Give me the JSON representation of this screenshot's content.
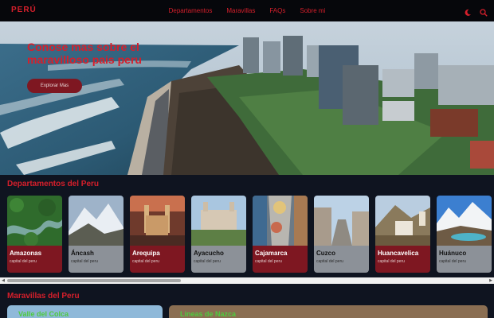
{
  "brand": "PERÚ",
  "nav": {
    "links": [
      "Departamentos",
      "Maravillas",
      "FAQs",
      "Sobre mi"
    ],
    "icons": [
      "moon-icon",
      "search-icon"
    ]
  },
  "hero": {
    "title": "Conose mas sobre el maravilloso pais peru",
    "button": "Explorar Mas"
  },
  "departments": {
    "title": "Departamentos del Peru",
    "items": [
      {
        "name": "Amazonas",
        "sub": "capital del peru",
        "style": "red"
      },
      {
        "name": "Áncash",
        "sub": "capital del peru",
        "style": "gray"
      },
      {
        "name": "Arequipa",
        "sub": "capital del peru",
        "style": "red"
      },
      {
        "name": "Ayacucho",
        "sub": "capital del peru",
        "style": "gray"
      },
      {
        "name": "Cajamarca",
        "sub": "capital del peru",
        "style": "red"
      },
      {
        "name": "Cuzco",
        "sub": "capital del peru",
        "style": "gray"
      },
      {
        "name": "Huancavelica",
        "sub": "capital del peru",
        "style": "red"
      },
      {
        "name": "Huánuco",
        "sub": "capital del peru",
        "style": "gray"
      }
    ]
  },
  "wonders": {
    "title": "Maravillas del Peru",
    "items": [
      "Valle del Colca",
      "Lineas de Nazca"
    ]
  },
  "colors": {
    "accent": "#d61f2b",
    "dark_red": "#7e1721",
    "background": "#0f1420"
  }
}
